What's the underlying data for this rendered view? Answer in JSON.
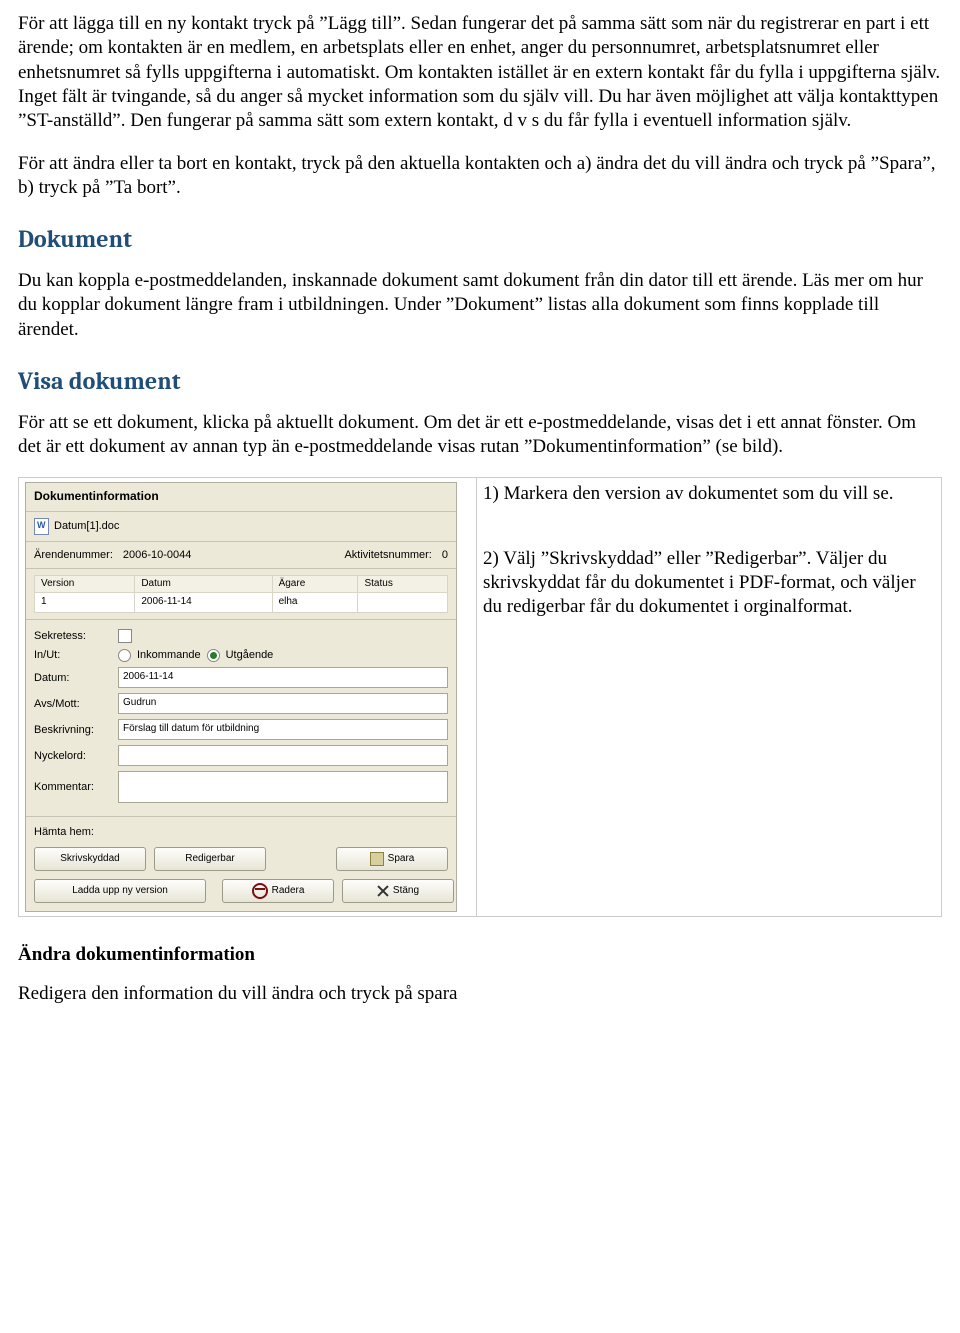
{
  "paragraphs": {
    "p1": "För att lägga till en ny kontakt tryck på ”Lägg till”. Sedan fungerar det på samma sätt som när du registrerar en part i ett ärende; om kontakten är en medlem, en arbetsplats eller en enhet, anger du personnumret, arbetsplatsnumret eller enhetsnumret så fylls uppgifterna i automatiskt. Om kontakten istället är en extern kontakt får du fylla i uppgifterna själv. Inget fält är tvingande, så du anger så mycket information som du själv vill. Du har även möjlighet att välja kontakttypen ”ST-anställd”. Den fungerar på samma sätt som extern kontakt, d v s du får fylla i eventuell information själv.",
    "p2": "För att ändra eller ta bort en kontakt, tryck på den aktuella kontakten och a) ändra det du vill ändra och tryck på ”Spara”, b) tryck på ”Ta bort”.",
    "p3": "Du kan koppla e-postmeddelanden, inskannade dokument samt dokument från din dator till ett ärende. Läs mer om hur du kopplar dokument längre fram i utbildningen. Under ”Dokument” listas alla dokument som finns kopplade till ärendet.",
    "p4": "För att se ett dokument, klicka på aktuellt dokument. Om det är ett e-postmeddelande, visas det i ett annat fönster. Om det är ett dokument av annan typ än e-postmeddelande visas rutan ”Dokumentinformation” (se bild).",
    "step1": "1) Markera den version av dokumentet som du vill se.",
    "step2": "2) Välj ”Skrivskyddad” eller ”Redigerbar”. Väljer du skrivskyddat får du dokumentet i PDF-format, och väljer du redigerbar får du dokumentet i orginalformat.",
    "p5": "Redigera den information du vill ändra och tryck på spara"
  },
  "headings": {
    "h_dokument": "Dokument",
    "h_visa": "Visa dokument",
    "h_andra": "Ändra dokumentinformation"
  },
  "panel": {
    "title": "Dokumentinformation",
    "filename": "Datum[1].doc",
    "arende_lbl": "Ärendenummer:",
    "arende_val": "2006-10-0044",
    "aktiv_lbl": "Aktivitetsnummer:",
    "aktiv_val": "0",
    "grid": {
      "h_version": "Version",
      "h_datum": "Datum",
      "h_agare": "Ägare",
      "h_status": "Status",
      "r_version": "1",
      "r_datum": "2006-11-14",
      "r_agare": "elha",
      "r_status": ""
    },
    "form": {
      "sekretess": "Sekretess:",
      "inut": "In/Ut:",
      "inkommande": "Inkommande",
      "utgaende": "Utgående",
      "datum_lbl": "Datum:",
      "datum_val": "2006-11-14",
      "avs_lbl": "Avs/Mott:",
      "avs_val": "Gudrun",
      "beskr_lbl": "Beskrivning:",
      "beskr_val": "Förslag till datum för utbildning",
      "nyckel_lbl": "Nyckelord:",
      "nyckel_val": "",
      "komm_lbl": "Kommentar:",
      "komm_val": ""
    },
    "footer": {
      "hamta": "Hämta hem:",
      "skrivskyddad": "Skrivskyddad",
      "redigerbar": "Redigerbar",
      "spara": "Spara",
      "ladda": "Ladda upp ny version",
      "radera": "Radera",
      "stang": "Stäng"
    }
  }
}
